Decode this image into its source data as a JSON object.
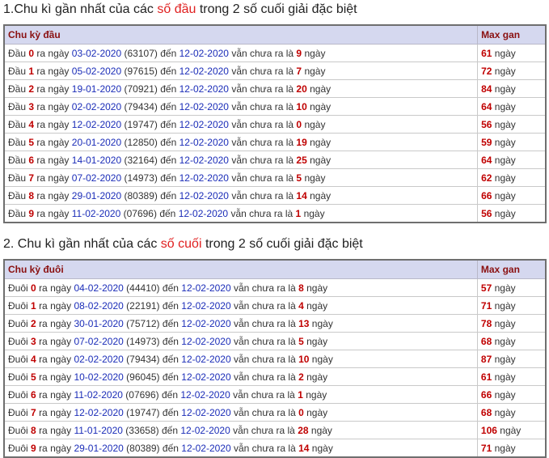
{
  "section1": {
    "heading": {
      "prefix": "1.Chu kì gần nhất của các ",
      "highlight": "số đầu",
      "suffix": " trong 2 số cuối giải đặc biệt"
    },
    "col1": "Chu kỳ đầu",
    "col2": "Max gan",
    "rows": [
      {
        "label": "Đầu",
        "digit": "0",
        "ra": "ra ngày",
        "date1": "03-02-2020",
        "code": "(63107)",
        "den": "đến",
        "date2": "12-02-2020",
        "vc": "vẫn chưa ra là",
        "days": "9",
        "ngay": "ngày",
        "max": "61",
        "maxUnit": "ngày"
      },
      {
        "label": "Đầu",
        "digit": "1",
        "ra": "ra ngày",
        "date1": "05-02-2020",
        "code": "(97615)",
        "den": "đến",
        "date2": "12-02-2020",
        "vc": "vẫn chưa ra là",
        "days": "7",
        "ngay": "ngày",
        "max": "72",
        "maxUnit": "ngày"
      },
      {
        "label": "Đầu",
        "digit": "2",
        "ra": "ra ngày",
        "date1": "19-01-2020",
        "code": "(70921)",
        "den": "đến",
        "date2": "12-02-2020",
        "vc": "vẫn chưa ra là",
        "days": "20",
        "ngay": "ngày",
        "max": "84",
        "maxUnit": "ngày"
      },
      {
        "label": "Đầu",
        "digit": "3",
        "ra": "ra ngày",
        "date1": "02-02-2020",
        "code": "(79434)",
        "den": "đến",
        "date2": "12-02-2020",
        "vc": "vẫn chưa ra là",
        "days": "10",
        "ngay": "ngày",
        "max": "64",
        "maxUnit": "ngày"
      },
      {
        "label": "Đầu",
        "digit": "4",
        "ra": "ra ngày",
        "date1": "12-02-2020",
        "code": "(19747)",
        "den": "đến",
        "date2": "12-02-2020",
        "vc": "vẫn chưa ra là",
        "days": "0",
        "ngay": "ngày",
        "max": "56",
        "maxUnit": "ngày"
      },
      {
        "label": "Đầu",
        "digit": "5",
        "ra": "ra ngày",
        "date1": "20-01-2020",
        "code": "(12850)",
        "den": "đến",
        "date2": "12-02-2020",
        "vc": "vẫn chưa ra là",
        "days": "19",
        "ngay": "ngày",
        "max": "59",
        "maxUnit": "ngày"
      },
      {
        "label": "Đầu",
        "digit": "6",
        "ra": "ra ngày",
        "date1": "14-01-2020",
        "code": "(32164)",
        "den": "đến",
        "date2": "12-02-2020",
        "vc": "vẫn chưa ra là",
        "days": "25",
        "ngay": "ngày",
        "max": "64",
        "maxUnit": "ngày"
      },
      {
        "label": "Đầu",
        "digit": "7",
        "ra": "ra ngày",
        "date1": "07-02-2020",
        "code": "(14973)",
        "den": "đến",
        "date2": "12-02-2020",
        "vc": "vẫn chưa ra là",
        "days": "5",
        "ngay": "ngày",
        "max": "62",
        "maxUnit": "ngày"
      },
      {
        "label": "Đầu",
        "digit": "8",
        "ra": "ra ngày",
        "date1": "29-01-2020",
        "code": "(80389)",
        "den": "đến",
        "date2": "12-02-2020",
        "vc": "vẫn chưa ra là",
        "days": "14",
        "ngay": "ngày",
        "max": "66",
        "maxUnit": "ngày"
      },
      {
        "label": "Đầu",
        "digit": "9",
        "ra": "ra ngày",
        "date1": "11-02-2020",
        "code": "(07696)",
        "den": "đến",
        "date2": "12-02-2020",
        "vc": "vẫn chưa ra là",
        "days": "1",
        "ngay": "ngày",
        "max": "56",
        "maxUnit": "ngày"
      }
    ]
  },
  "section2": {
    "heading": {
      "prefix": "2. Chu kì gần nhất của các ",
      "highlight": "số cuối",
      "suffix": " trong 2 số cuối giải đặc biệt"
    },
    "col1": "Chu kỳ đuôi",
    "col2": "Max gan",
    "rows": [
      {
        "label": "Đuôi",
        "digit": "0",
        "ra": "ra ngày",
        "date1": "04-02-2020",
        "code": "(44410)",
        "den": "đến",
        "date2": "12-02-2020",
        "vc": "vẫn chưa ra là",
        "days": "8",
        "ngay": "ngày",
        "max": "57",
        "maxUnit": "ngày"
      },
      {
        "label": "Đuôi",
        "digit": "1",
        "ra": "ra ngày",
        "date1": "08-02-2020",
        "code": "(22191)",
        "den": "đến",
        "date2": "12-02-2020",
        "vc": "vẫn chưa ra là",
        "days": "4",
        "ngay": "ngày",
        "max": "71",
        "maxUnit": "ngày"
      },
      {
        "label": "Đuôi",
        "digit": "2",
        "ra": "ra ngày",
        "date1": "30-01-2020",
        "code": "(75712)",
        "den": "đến",
        "date2": "12-02-2020",
        "vc": "vẫn chưa ra là",
        "days": "13",
        "ngay": "ngày",
        "max": "78",
        "maxUnit": "ngày"
      },
      {
        "label": "Đuôi",
        "digit": "3",
        "ra": "ra ngày",
        "date1": "07-02-2020",
        "code": "(14973)",
        "den": "đến",
        "date2": "12-02-2020",
        "vc": "vẫn chưa ra là",
        "days": "5",
        "ngay": "ngày",
        "max": "68",
        "maxUnit": "ngày"
      },
      {
        "label": "Đuôi",
        "digit": "4",
        "ra": "ra ngày",
        "date1": "02-02-2020",
        "code": "(79434)",
        "den": "đến",
        "date2": "12-02-2020",
        "vc": "vẫn chưa ra là",
        "days": "10",
        "ngay": "ngày",
        "max": "87",
        "maxUnit": "ngày"
      },
      {
        "label": "Đuôi",
        "digit": "5",
        "ra": "ra ngày",
        "date1": "10-02-2020",
        "code": "(96045)",
        "den": "đến",
        "date2": "12-02-2020",
        "vc": "vẫn chưa ra là",
        "days": "2",
        "ngay": "ngày",
        "max": "61",
        "maxUnit": "ngày"
      },
      {
        "label": "Đuôi",
        "digit": "6",
        "ra": "ra ngày",
        "date1": "11-02-2020",
        "code": "(07696)",
        "den": "đến",
        "date2": "12-02-2020",
        "vc": "vẫn chưa ra là",
        "days": "1",
        "ngay": "ngày",
        "max": "66",
        "maxUnit": "ngày"
      },
      {
        "label": "Đuôi",
        "digit": "7",
        "ra": "ra ngày",
        "date1": "12-02-2020",
        "code": "(19747)",
        "den": "đến",
        "date2": "12-02-2020",
        "vc": "vẫn chưa ra là",
        "days": "0",
        "ngay": "ngày",
        "max": "68",
        "maxUnit": "ngày"
      },
      {
        "label": "Đuôi",
        "digit": "8",
        "ra": "ra ngày",
        "date1": "11-01-2020",
        "code": "(33658)",
        "den": "đến",
        "date2": "12-02-2020",
        "vc": "vẫn chưa ra là",
        "days": "28",
        "ngay": "ngày",
        "max": "106",
        "maxUnit": "ngày"
      },
      {
        "label": "Đuôi",
        "digit": "9",
        "ra": "ra ngày",
        "date1": "29-01-2020",
        "code": "(80389)",
        "den": "đến",
        "date2": "12-02-2020",
        "vc": "vẫn chưa ra là",
        "days": "14",
        "ngay": "ngày",
        "max": "71",
        "maxUnit": "ngày"
      }
    ]
  },
  "colors": {
    "header_bg": "#d5d8ef",
    "header_text": "#8a1010",
    "highlight_red": "#e02020",
    "number_red": "#c00000",
    "date_blue": "#1b2db8"
  }
}
